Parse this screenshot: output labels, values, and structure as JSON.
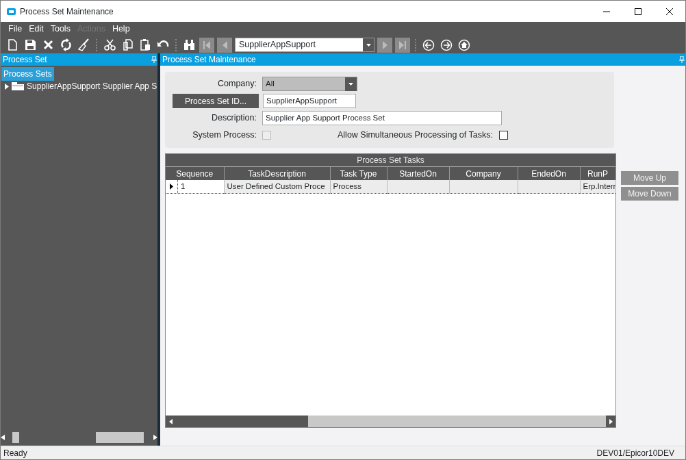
{
  "window": {
    "title": "Process Set Maintenance"
  },
  "menu": [
    {
      "label": "File",
      "disabled": false
    },
    {
      "label": "Edit",
      "disabled": false
    },
    {
      "label": "Tools",
      "disabled": false
    },
    {
      "label": "Actions",
      "disabled": true
    },
    {
      "label": "Help",
      "disabled": false
    }
  ],
  "toolbar": {
    "navigator_value": "SupplierAppSupport"
  },
  "left_panel": {
    "title": "Process Set",
    "tree_header": {
      "label": "Process Sets",
      "selected": true
    },
    "tree": [
      {
        "label": "SupplierAppSupport  Supplier App S",
        "expanded": false
      }
    ]
  },
  "main_panel": {
    "title": "Process Set Maintenance",
    "form": {
      "company": {
        "label": "Company:",
        "value": "All"
      },
      "process_set_id": {
        "button": "Process Set ID...",
        "value": "SupplierAppSupport"
      },
      "description": {
        "label": "Description:",
        "value": "Supplier App Support Process Set"
      },
      "system_process": {
        "label": "System Process:",
        "checked": false,
        "disabled": true
      },
      "allow_simultaneous": {
        "label": "Allow Simultaneous Processing of Tasks:",
        "checked": false,
        "disabled": false
      }
    },
    "grid": {
      "title": "Process Set Tasks",
      "columns": [
        "Sequence",
        "TaskDescription",
        "Task Type",
        "StartedOn",
        "Company",
        "EndedOn",
        "RunP"
      ],
      "rows": [
        {
          "current": true,
          "cells": [
            "1",
            "User Defined Custom Proce",
            "Process",
            null,
            null,
            null,
            "Erp.Interr"
          ]
        }
      ]
    },
    "buttons": [
      {
        "label": "Move Up",
        "disabled": true
      },
      {
        "label": "Move Down",
        "disabled": true
      }
    ]
  },
  "status_bar": {
    "left": "Ready",
    "right": "DEV01/Epicor10DEV"
  }
}
